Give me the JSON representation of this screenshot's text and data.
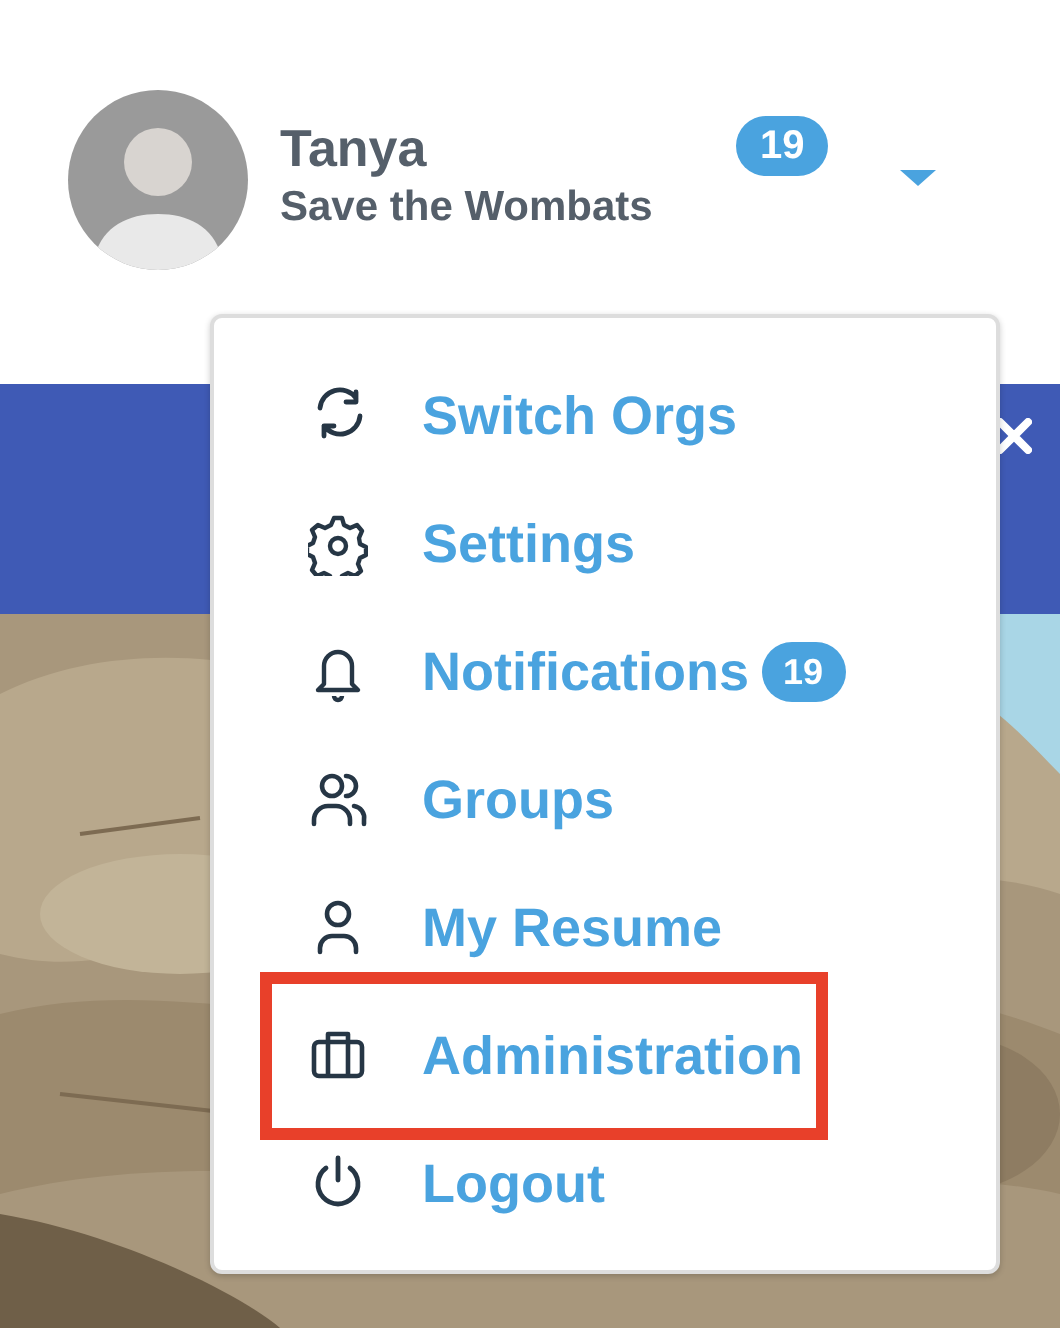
{
  "user": {
    "name": "Tanya",
    "org": "Save the Wombats",
    "badge": "19"
  },
  "menu": {
    "items": [
      {
        "label": "Switch Orgs",
        "highlighted": false
      },
      {
        "label": "Settings",
        "highlighted": false
      },
      {
        "label": "Notifications",
        "badge": "19",
        "highlighted": false
      },
      {
        "label": "Groups",
        "highlighted": false
      },
      {
        "label": "My Resume",
        "highlighted": false
      },
      {
        "label": "Administration",
        "highlighted": true
      },
      {
        "label": "Logout",
        "highlighted": false
      }
    ]
  }
}
